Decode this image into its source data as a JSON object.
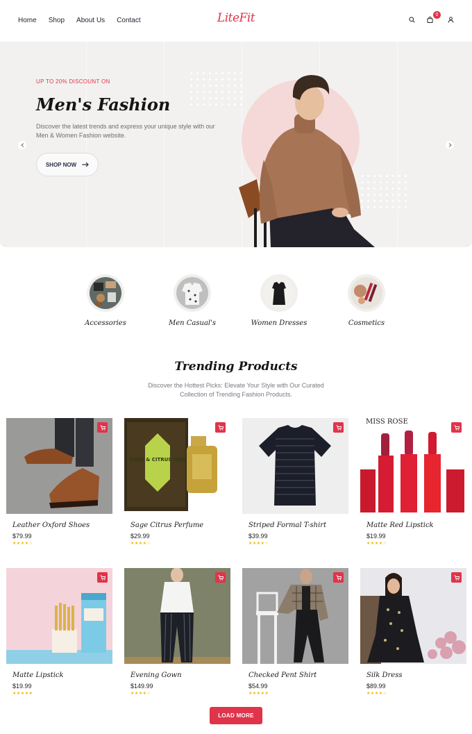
{
  "brand": {
    "logo": "LiteFit",
    "accent": "#e0344a"
  },
  "nav": {
    "items": [
      "Home",
      "Shop",
      "About Us",
      "Contact"
    ]
  },
  "header_icons": {
    "search": "search-icon",
    "cart": "shopping-bag-icon",
    "cart_count": "0",
    "account": "user-icon"
  },
  "hero": {
    "eyebrow": "UP TO 20% DISCOUNT ON",
    "title": "Men's Fashion",
    "subtitle": "Discover the latest trends and express your unique style with our Men & Women Fashion website.",
    "cta": "SHOP NOW"
  },
  "categories": [
    {
      "label": "Accessories"
    },
    {
      "label": "Men Casual's"
    },
    {
      "label": "Women Dresses"
    },
    {
      "label": "Cosmetics"
    }
  ],
  "trending": {
    "title": "Trending Products",
    "subtitle": "Discover the Hottest Picks: Elevate Your Style with Our Curated Collection of Trending Fashion Products.",
    "products": [
      {
        "name": "Leather Oxford Shoes",
        "price": "$79.99",
        "stars": "★★★★☆"
      },
      {
        "name": "Sage Citrus Perfume",
        "price": "$29.99",
        "stars": "★★★★☆"
      },
      {
        "name": "Striped Formal T-shirt",
        "price": "$39.99",
        "stars": "★★★★☆"
      },
      {
        "name": "Matte Red Lipstick",
        "price": "$19.99",
        "stars": "★★★★☆"
      },
      {
        "name": "Matte Lipstick",
        "price": "$19.99",
        "stars": "★★★★★"
      },
      {
        "name": "Evening Gown",
        "price": "$149.99",
        "stars": "★★★★☆"
      },
      {
        "name": "Checked Pent Shirt",
        "price": "$54.99",
        "stars": "★★★★★"
      },
      {
        "name": "Silk Dress",
        "price": "$89.99",
        "stars": "★★★★☆"
      }
    ],
    "load_more": "LOAD MORE"
  },
  "image_text": {
    "perfume_box": "SAGE & CITRUS OUD",
    "lipstick_brand": "MISS ROSE"
  }
}
